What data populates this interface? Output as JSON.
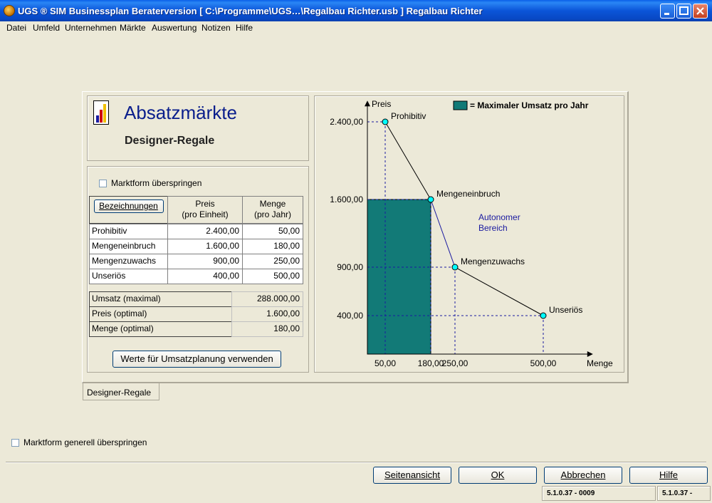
{
  "window": {
    "title": "UGS ® SIM Businessplan Beraterversion   [ C:\\Programme\\UGS…\\Regalbau Richter.usb ] Regalbau Richter"
  },
  "menu": [
    "Datei",
    "Umfeld",
    "Unternehmen",
    "Märkte",
    "Auswertung",
    "Notizen",
    "Hilfe"
  ],
  "header": {
    "title": "Absatzmärkte",
    "subtitle": "Designer-Regale"
  },
  "form": {
    "skip_label": "Marktform überspringen",
    "skip_checked": false,
    "columns": {
      "name": "Bezeichnungen",
      "price": "Preis\n(pro Einheit)",
      "qty": "Menge\n(pro Jahr)"
    },
    "rows": [
      {
        "name": "Prohibitiv",
        "price": "2.400,00",
        "qty": "50,00"
      },
      {
        "name": "Mengeneinbruch",
        "price": "1.600,00",
        "qty": "180,00"
      },
      {
        "name": "Mengenzuwachs",
        "price": "900,00",
        "qty": "250,00"
      },
      {
        "name": "Unseriös",
        "price": "400,00",
        "qty": "500,00"
      }
    ],
    "summary": [
      {
        "label": "Umsatz (maximal)",
        "value": "288.000,00"
      },
      {
        "label": "Preis (optimal)",
        "value": "1.600,00"
      },
      {
        "label": "Menge (optimal)",
        "value": "180,00"
      }
    ],
    "apply_button": "Werte für Umsatzplanung verwenden"
  },
  "tab": {
    "label": "Designer-Regale"
  },
  "global_skip": {
    "label": "Marktform generell überspringen",
    "checked": false
  },
  "buttons": {
    "preview": "Seitenansicht",
    "ok": "OK",
    "cancel": "Abbrechen",
    "help": "Hilfe"
  },
  "status": {
    "left": "5.1.0.37 - 0009",
    "right": "5.1.0.37 -"
  },
  "colors": {
    "area_fill": "#127A77",
    "point_fill": "#00FFFF",
    "title_blue": "#0A1E8C",
    "annotation_blue": "#1A1AA0"
  },
  "chart_data": {
    "type": "line",
    "xlabel": "Menge",
    "ylabel": "Preis",
    "legend": "= Maximaler Umsatz pro Jahr",
    "legend_position": "top-right",
    "annotation": "Autonomer\nBereich",
    "x_ticks": [
      {
        "value": 50,
        "label": "50,00"
      },
      {
        "value": 180,
        "label": "180,00"
      },
      {
        "value": 250,
        "label": "250,00"
      },
      {
        "value": 500,
        "label": "500,00"
      }
    ],
    "y_ticks": [
      {
        "value": 2400,
        "label": "2.400,00"
      },
      {
        "value": 1600,
        "label": "1.600,00"
      },
      {
        "value": 900,
        "label": "900,00"
      },
      {
        "value": 400,
        "label": "400,00"
      }
    ],
    "points": [
      {
        "name": "Prohibitiv",
        "x": 50,
        "y": 2400
      },
      {
        "name": "Mengeneinbruch",
        "x": 180,
        "y": 1600
      },
      {
        "name": "Mengenzuwachs",
        "x": 250,
        "y": 900
      },
      {
        "name": "Unseriös",
        "x": 500,
        "y": 400
      }
    ],
    "revenue_area": {
      "x": 180,
      "y": 1600
    }
  }
}
